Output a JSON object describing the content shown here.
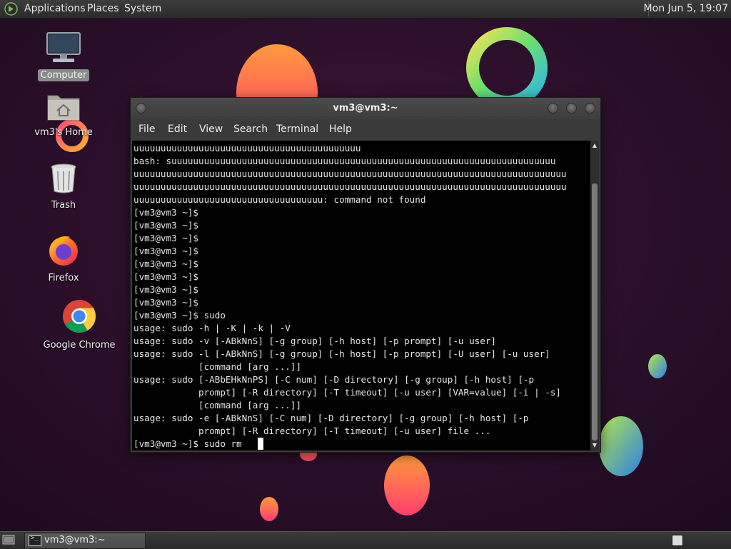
{
  "colors": {
    "panel_bg": "#2b2b2b",
    "terminal_bg": "#000000",
    "terminal_fg": "#e6e6e6",
    "wallpaper_bg": "#2a0f2a"
  },
  "top_panel": {
    "logo_icon": "distro-logo-icon",
    "menus": [
      "Applications",
      "Places",
      "System"
    ],
    "clock": "Mon Jun  5, 19:07"
  },
  "desktop_icons": [
    {
      "label": "Computer",
      "icon": "computer-icon"
    },
    {
      "label": "vm3's Home",
      "icon": "home-folder-icon"
    },
    {
      "label": "Trash",
      "icon": "trash-icon"
    },
    {
      "label": "Firefox",
      "icon": "firefox-icon"
    },
    {
      "label": "Google Chrome",
      "icon": "chrome-icon"
    }
  ],
  "terminal": {
    "title": "vm3@vm3:~",
    "menu": [
      "File",
      "Edit",
      "View",
      "Search",
      "Terminal",
      "Help"
    ],
    "lines": [
      "uuuuuuuuuuuuuuuuuuuuuuuuuuuuuuuuuuuuuuuuuu",
      "bash: suuuuuuuuuuuuuuuuuuuuuuuuuuuuuuuuuuuuuuuuuuuuuuuuuuuuuuuuuuuuuuuuuuuuuuu",
      "uuuuuuuuuuuuuuuuuuuuuuuuuuuuuuuuuuuuuuuuuuuuuuuuuuuuuuuuuuuuuuuuuuuuuuuuuuuuuuuu",
      "uuuuuuuuuuuuuuuuuuuuuuuuuuuuuuuuuuuuuuuuuuuuuuuuuuuuuuuuuuuuuuuuuuuuuuuuuuuuuuuu",
      "uuuuuuuuuuuuuuuuuuuuuuuuuuuuuuuuuuu: command not found",
      "[vm3@vm3 ~]$",
      "[vm3@vm3 ~]$",
      "[vm3@vm3 ~]$",
      "[vm3@vm3 ~]$",
      "[vm3@vm3 ~]$",
      "[vm3@vm3 ~]$",
      "[vm3@vm3 ~]$",
      "[vm3@vm3 ~]$",
      "[vm3@vm3 ~]$ sudo",
      "usage: sudo -h | -K | -k | -V",
      "usage: sudo -v [-ABkNnS] [-g group] [-h host] [-p prompt] [-u user]",
      "usage: sudo -l [-ABkNnS] [-g group] [-h host] [-p prompt] [-U user] [-u user]",
      "            [command [arg ...]]",
      "usage: sudo [-ABbEHkNnPS] [-C num] [-D directory] [-g group] [-h host] [-p",
      "            prompt] [-R directory] [-T timeout] [-u user] [VAR=value] [-i | -s]",
      "            [command [arg ...]]",
      "usage: sudo -e [-ABkNnS] [-C num] [-D directory] [-g group] [-h host] [-p",
      "            prompt] [-R directory] [-T timeout] [-u user] file ..."
    ],
    "current_input": "[vm3@vm3 ~]$ sudo rm   "
  },
  "taskbar": {
    "items": [
      {
        "label": "vm3@vm3:~",
        "icon": "terminal-icon"
      }
    ]
  }
}
